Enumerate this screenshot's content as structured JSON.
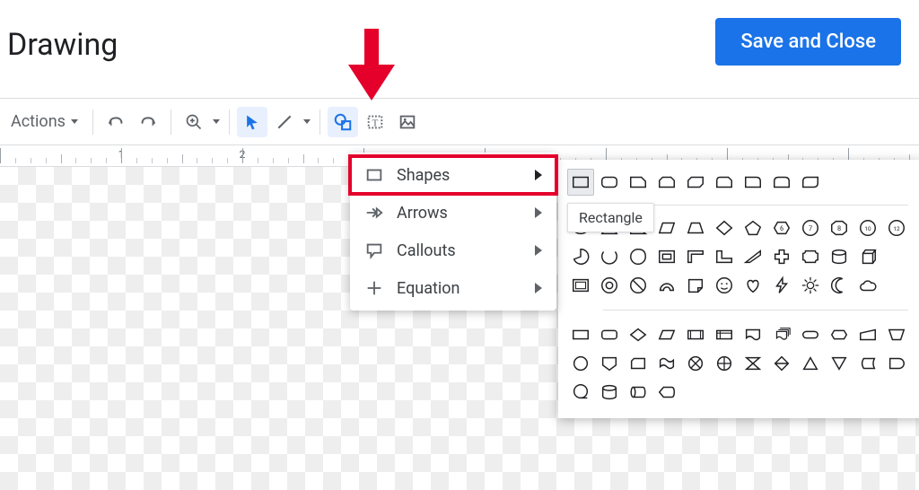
{
  "header": {
    "title": "Drawing",
    "save_label": "Save and Close"
  },
  "toolbar": {
    "actions_label": "Actions",
    "select_tool": "select",
    "line_tool": "line",
    "shape_tool": "shape",
    "textbox_tool": "textbox",
    "image_tool": "image"
  },
  "ruler": {
    "visible_numbers": [
      "1",
      "2"
    ]
  },
  "shape_menu": {
    "items": [
      {
        "icon": "rectangle-outline",
        "label": "Shapes",
        "highlight": true
      },
      {
        "icon": "arrow-right-outline",
        "label": "Arrows"
      },
      {
        "icon": "callout-outline",
        "label": "Callouts"
      },
      {
        "icon": "equation-plus",
        "label": "Equation"
      }
    ]
  },
  "tooltip": {
    "label": "Rectangle"
  },
  "shapes_gallery": {
    "selected": "rectangle",
    "group1_row1": [
      "rectangle",
      "rounded-rectangle",
      "snip-single",
      "snip-same",
      "snip-diag",
      "snip-round",
      "round-single",
      "round-same",
      "round-diag"
    ],
    "group1_row2": [
      "oval",
      "triangle",
      "right-triangle",
      "parallelogram",
      "trapezoid",
      "diamond",
      "pentagon",
      "hexagon",
      "heptagon",
      "octagon",
      "decagon",
      "dodecagon"
    ],
    "group1_row3": [
      "pie",
      "arc",
      "teardrop",
      "frame",
      "half-frame",
      "l-shape",
      "diag-stripe",
      "cross",
      "plaque",
      "can",
      "cube"
    ],
    "group1_row4": [
      "bevel",
      "donut",
      "no-symbol",
      "block-arc",
      "folded-corner",
      "smiley",
      "heart",
      "lightning",
      "sun",
      "moon",
      "cloud"
    ],
    "group2_row1": [
      "flow-process",
      "flow-alt-process",
      "flow-decision",
      "flow-data",
      "flow-predefined",
      "flow-internal",
      "flow-document",
      "flow-multi",
      "flow-terminator",
      "flow-preparation",
      "flow-manual-input",
      "flow-manual-op"
    ],
    "group2_row2": [
      "flow-connector",
      "flow-offpage",
      "flow-card",
      "flow-tape",
      "flow-junction",
      "flow-or",
      "flow-collate",
      "flow-sort",
      "flow-extract",
      "flow-merge",
      "flow-stored",
      "flow-delay"
    ],
    "group2_row3": [
      "flow-seq",
      "flow-magnetic",
      "flow-direct",
      "flow-display"
    ]
  }
}
